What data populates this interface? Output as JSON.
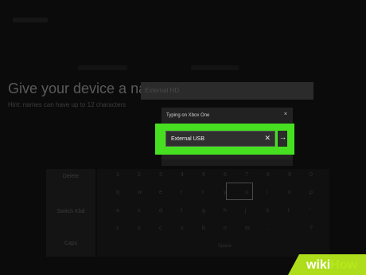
{
  "setup": {
    "heading": "Give your device a name",
    "subtext": "Hint: names can have up to 12 characters",
    "name_placeholder": "External HD"
  },
  "dialog": {
    "title": "Typing on Xbox One",
    "close_glyph": "×",
    "input_value": "External USB",
    "clear_glyph": "✕",
    "go_glyph": "→"
  },
  "keyboard": {
    "left_items": [
      "Delete",
      "Switch Kbd",
      "Caps"
    ],
    "keys": [
      [
        "1",
        "2",
        "3",
        "4",
        "5",
        "6",
        "7",
        "8",
        "9",
        "0"
      ],
      [
        "q",
        "w",
        "e",
        "r",
        "t",
        "y",
        "u",
        "i",
        "o",
        "p"
      ],
      [
        "a",
        "s",
        "d",
        "f",
        "g",
        "h",
        "j",
        "k",
        "l",
        "'"
      ],
      [
        "z",
        "x",
        "c",
        "v",
        "b",
        "n",
        "m",
        ",",
        ".",
        "?"
      ]
    ],
    "space_label": "Space"
  },
  "colors": {
    "highlight": "#47e021",
    "brand_how": "#b6e91c",
    "background": "#0b0b0b"
  },
  "watermark": {
    "part1": "wiki",
    "part2": "How"
  }
}
